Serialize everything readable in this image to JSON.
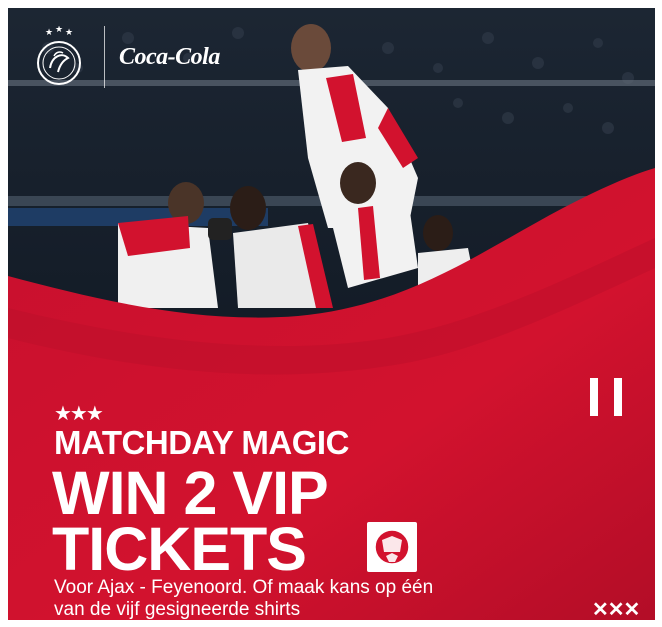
{
  "brand": {
    "club": "AJAX",
    "sponsor": "Coca-Cola"
  },
  "promo": {
    "stars": "★★★",
    "kicker": "MATCHDAY MAGIC",
    "headline_line1": "WIN 2 VIP",
    "headline_line2": "TICKETS",
    "subline_1": "Voor Ajax - Feyenoord. Of maak kans op één",
    "subline_2": "van de vijf gesigneerde shirts",
    "footer_mark": "✕✕✕"
  },
  "icons": {
    "ball": "football-icon",
    "pause": "pause-icon",
    "club_logo": "ajax-logo-icon"
  },
  "colors": {
    "ajax_red": "#d2122e",
    "dark_red": "#a50e25",
    "white": "#ffffff"
  }
}
